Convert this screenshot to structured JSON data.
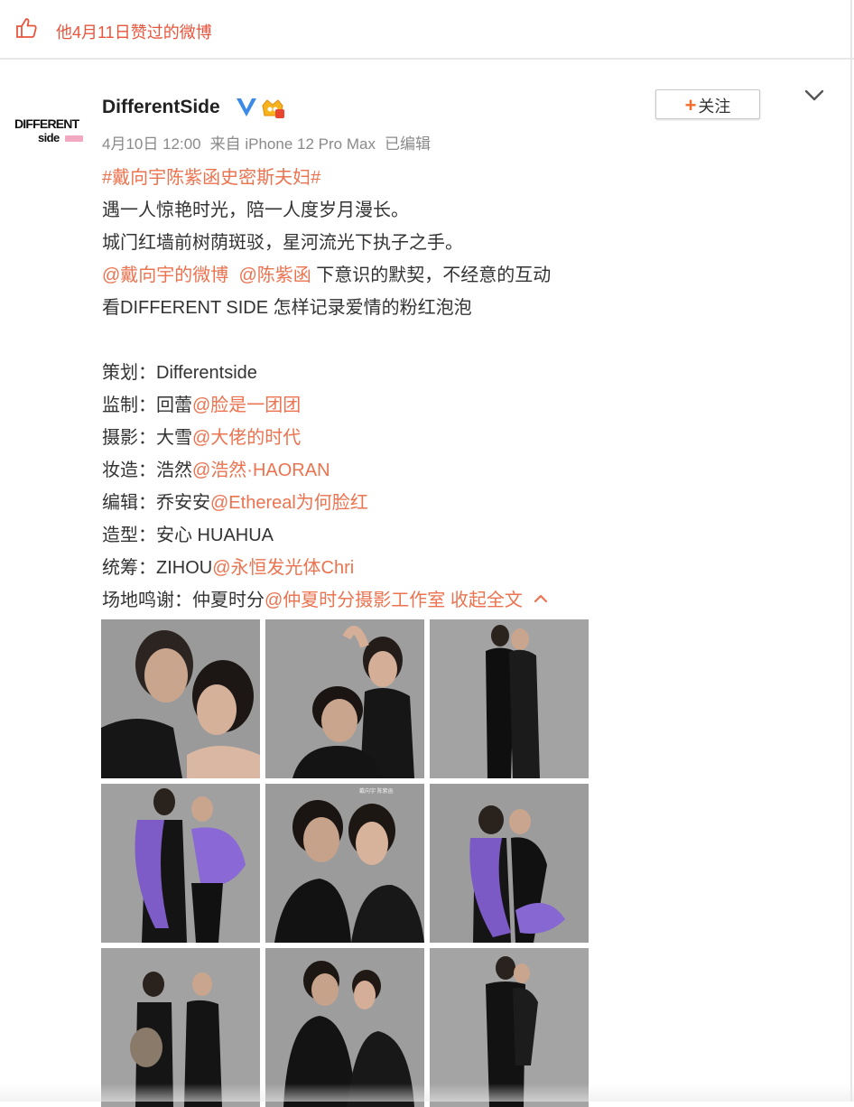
{
  "like_bar": {
    "text": "他4月11日赞过的微博",
    "icon": "thumbs-up-icon"
  },
  "author": {
    "name": "DifferentSide",
    "avatar_text_1": "DIFFERENT",
    "avatar_text_2": "side",
    "verified_icon": "verified-v-icon",
    "member_icon": "vip-crown-icon",
    "time": "4月10日 12:00",
    "source": "来自 iPhone 12 Pro Max",
    "edited": "已编辑"
  },
  "follow_button": {
    "plus": "+",
    "label": "关注"
  },
  "more_icon": "chevron-down-icon",
  "post": {
    "hashtag": "#戴向宇陈紫函史密斯夫妇#",
    "line1": "遇一人惊艳时光，陪一人度岁月漫长。",
    "line2": "城门红墙前树荫斑驳，星河流光下执子之手。",
    "mention1": "@戴向宇的微博",
    "mention2": "@陈紫函",
    "line3_rest": " 下意识的默契，不经意的互动",
    "line4": "看DIFFERENT SIDE 怎样记录爱情的粉红泡泡",
    "credits": [
      {
        "label": "策划：",
        "plain": "Differentside",
        "link": ""
      },
      {
        "label": "监制：",
        "plain": "回蕾",
        "link": "@脸是一团团"
      },
      {
        "label": "摄影：",
        "plain": "大雪",
        "link": "@大佬的时代"
      },
      {
        "label": "妆造：",
        "plain": "浩然",
        "link": "@浩然·HAORAN"
      },
      {
        "label": "编辑：",
        "plain": "乔安安",
        "link": "@Ethereal为何脸红"
      },
      {
        "label": "造型：",
        "plain": "安心 HUAHUA",
        "link": ""
      },
      {
        "label": "统筹：",
        "plain": "ZIHOU",
        "link": "@永恒发光体Chri"
      },
      {
        "label": "场地鸣谢：",
        "plain": "仲夏时分",
        "link": "@仲夏时分摄影工作室"
      }
    ],
    "collapse_label": "收起全文",
    "collapse_icon": "chevron-up-icon"
  },
  "photos": {
    "count": 9,
    "caption_on_5": "戴向宇 陈紫函"
  },
  "colors": {
    "link": "#eb7350",
    "accent": "#f26d2b",
    "meta": "#8a8a8a",
    "verified": "#3b8be6"
  }
}
